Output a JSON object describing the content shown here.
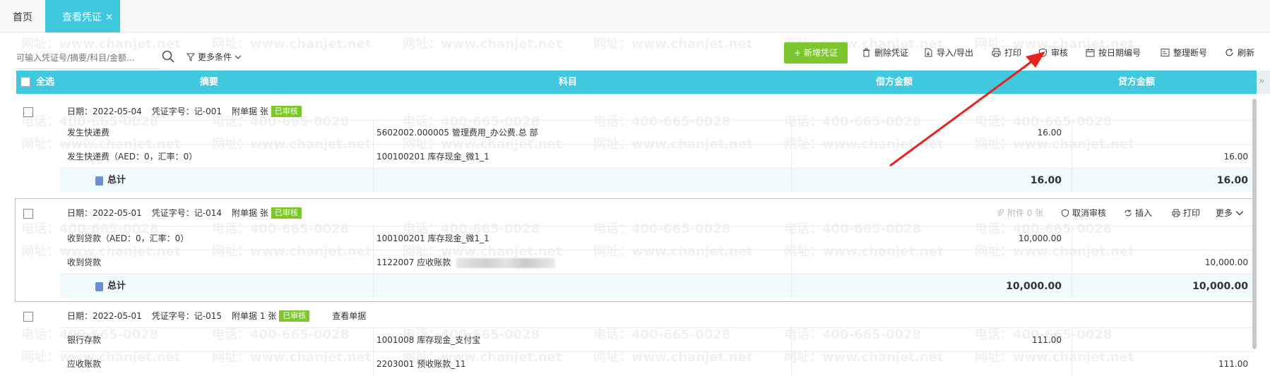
{
  "tabs": {
    "home": "首页",
    "active": "查看凭证",
    "close": "×"
  },
  "toolbar": {
    "search_placeholder": "可输入凭证号/摘要/科目/金额...",
    "filter_label": "更多条件",
    "new_voucher": "+ 新增凭证",
    "delete": "删除凭证",
    "import_export": "导入/导出",
    "print": "打印",
    "audit": "审核",
    "by_date_number": "按日期编号",
    "renumber": "整理断号",
    "refresh": "刷新"
  },
  "table_header": {
    "select_all": "全选",
    "summary": "摘要",
    "account": "科目",
    "debit": "借方金额",
    "credit": "贷方金额"
  },
  "vouchers": [
    {
      "date_label": "日期：2022-05-04",
      "number_label": "凭证字号：记-001",
      "attach_label": "附单据  张",
      "status": "已审核",
      "rows": [
        {
          "summary": "发生快递费",
          "account": "5602002.000005 管理费用_办公费.总 部",
          "debit": "16.00",
          "credit": ""
        },
        {
          "summary": "发生快递费（AED：0，汇率：0）",
          "account": "100100201 库存现金_微1_1",
          "debit": "",
          "credit": "16.00"
        }
      ],
      "total_label": "总计",
      "total_debit": "16.00",
      "total_credit": "16.00"
    },
    {
      "date_label": "日期：2022-05-01",
      "number_label": "凭证字号：记-014",
      "attach_label": "附单据  张",
      "status": "已审核",
      "actions": {
        "attachment": "附件 0 张",
        "cancel_audit": "取消审核",
        "insert": "插入",
        "print": "打印",
        "more": "更多"
      },
      "rows": [
        {
          "summary": "收到贷款（AED：0，汇率：0）",
          "account": "100100201 库存现金_微1_1",
          "debit": "10,000.00",
          "credit": ""
        },
        {
          "summary": "收到贷款",
          "account": "1122007 应收账款",
          "debit": "",
          "credit": "10,000.00"
        }
      ],
      "total_label": "总计",
      "total_debit": "10,000.00",
      "total_credit": "10,000.00"
    },
    {
      "date_label": "日期：2022-05-01",
      "number_label": "凭证字号：记-015",
      "attach_label": "附单据 1 张",
      "status": "已审核",
      "view_docs": "查看单据",
      "rows": [
        {
          "summary": "银行存款",
          "account": "1001008 库存现金_支付宝",
          "debit": "111.00",
          "credit": ""
        },
        {
          "summary": "应收账款",
          "account": "2203001 预收账款_11",
          "debit": "",
          "credit": "111.00"
        }
      ]
    }
  ],
  "watermark": {
    "phone": "电话：400-665-0028",
    "site": "网址：www.chanjet.net"
  },
  "colors": {
    "accent": "#3fc8de",
    "green": "#7dc62d",
    "arrow": "#e8231f"
  }
}
